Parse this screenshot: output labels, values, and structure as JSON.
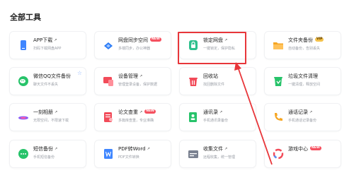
{
  "page": {
    "title": "全部工具"
  },
  "tools": [
    {
      "id": "app-download",
      "name": "APP下载",
      "desc": "扫码下载网盘APP",
      "icon": "phone-app-icon",
      "color": "#3f86ff",
      "arrow": true
    },
    {
      "id": "sync-space",
      "name": "网盘同步空间",
      "desc": "多端同步，办公神器",
      "icon": "sync-icon",
      "color": "#2b7cf7",
      "badge": "NEW"
    },
    {
      "id": "lock-disk",
      "name": "锁定网盘",
      "desc": "一键锁定，保护隐私",
      "icon": "lock-icon",
      "color": "#2fc08d",
      "arrow": true
    },
    {
      "id": "folder-backup",
      "name": "文件夹备份",
      "desc": "自动备份，告别丢失",
      "icon": "folder-icon",
      "color": "#f6a623",
      "badge": "VIP"
    },
    {
      "id": "wechat-qq-backup",
      "name": "微信QQ文件备份",
      "desc": "聊天文件不丢失",
      "icon": "wechat-icon",
      "color": "#27c36a"
    },
    {
      "id": "device-manage",
      "name": "设备管理",
      "desc": "管理登录设备，保护数据",
      "icon": "device-icon",
      "color": "#f24b59",
      "arrow": true
    },
    {
      "id": "recycle-bin",
      "name": "回收站",
      "desc": "找回删除文件",
      "icon": "trash-icon",
      "color": "#f24b59"
    },
    {
      "id": "trash-cleanup",
      "name": "垃圾文件清理",
      "desc": "一键清理，释放空间",
      "icon": "cleanup-icon",
      "color": "#27c36a"
    },
    {
      "id": "moment-album",
      "name": "一刻相册",
      "desc": "无限空间，不限速下载",
      "icon": "album-icon",
      "color": "#8a5cf6",
      "arrow": true
    },
    {
      "id": "thesis-check",
      "name": "论文查重",
      "desc": "多篇库查重，专业准确",
      "icon": "thesis-icon",
      "color": "#f24b59",
      "arrow": true,
      "badge": "NEW"
    },
    {
      "id": "contacts",
      "name": "通讯录",
      "desc": "手机通讯录备份",
      "icon": "contacts-icon",
      "color": "#27c36a",
      "arrow": true
    },
    {
      "id": "call-log",
      "name": "通话记录",
      "desc": "手机通话记录备份",
      "icon": "phone-call-icon",
      "color": "#f6a623",
      "arrow": true
    },
    {
      "id": "sms-backup",
      "name": "短信备份",
      "desc": "手机短信备份",
      "icon": "sms-icon",
      "color": "#27c36a",
      "arrow": true
    },
    {
      "id": "pdf-to-word",
      "name": "PDF转Word",
      "desc": "PDF文件转换",
      "icon": "pdf-word-icon",
      "color": "#3f86ff",
      "arrow": true
    },
    {
      "id": "collect-files",
      "name": "收集文件",
      "desc": "远程收集，统一管理",
      "icon": "collect-icon",
      "color": "#7a8190",
      "arrow": true
    },
    {
      "id": "game-center",
      "name": "游戏中心",
      "desc": "",
      "icon": "game-icon",
      "color": "#4a90ff",
      "badge": "NEW"
    }
  ]
}
